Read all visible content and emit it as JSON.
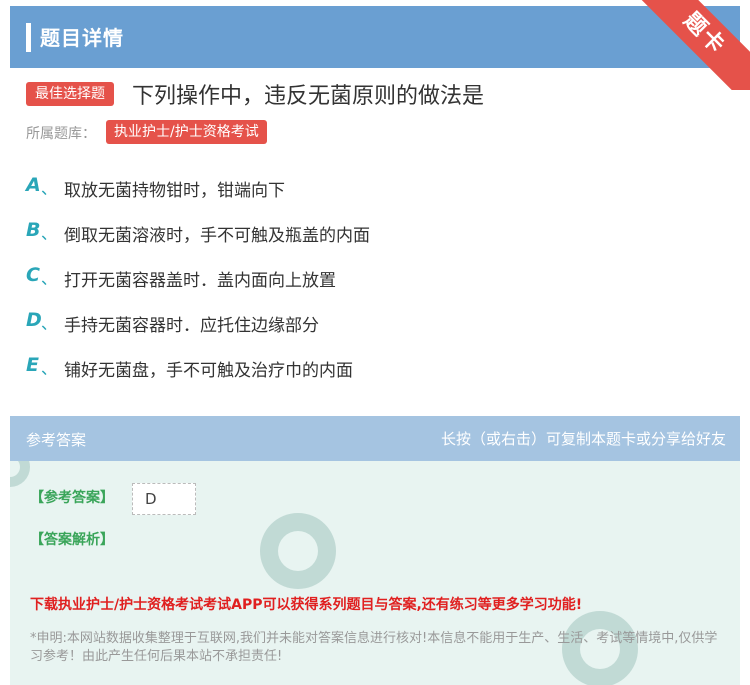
{
  "header": {
    "title": "题目详情",
    "corner_tag": "题卡"
  },
  "question": {
    "badge": "最佳选择题",
    "text": "下列操作中，违反无菌原则的做法是",
    "library_label": "所属题库：",
    "library_name": "执业护士/护士资格考试"
  },
  "options": [
    {
      "letter": "A",
      "sep": "、",
      "text": "取放无菌持物钳时，钳端向下"
    },
    {
      "letter": "B",
      "sep": "、",
      "text": "倒取无菌溶液时，手不可触及瓶盖的内面"
    },
    {
      "letter": "C",
      "sep": "、",
      "text": "打开无菌容器盖时．盖内面向上放置"
    },
    {
      "letter": "D",
      "sep": "、",
      "text": "手持无菌容器时．应托住边缘部分"
    },
    {
      "letter": "E",
      "sep": "、",
      "text": "铺好无菌盘，手不可触及治疗巾的内面"
    }
  ],
  "answer_section": {
    "title": "参考答案",
    "hint": "长按（或右击）可复制本题卡或分享给好友",
    "answer_label": "【参考答案】",
    "answer_value": "D",
    "explanation_label": "【答案解析】",
    "promo": "下载执业护士/护士资格考试考试APP可以获得系列题目与答案,还有练习等更多学习功能!",
    "disclaimer": "*申明:本网站数据收集整理于互联网,我们并未能对答案信息进行核对!本信息不能用于生产、生活、考试等情境中,仅供学习参考！由此产生任何后果本站不承担责任!"
  },
  "colors": {
    "header": "#6a9fd2",
    "accent_red": "#e5524a",
    "option_letter": "#2aa6b8",
    "answer_green": "#3aa55a"
  }
}
